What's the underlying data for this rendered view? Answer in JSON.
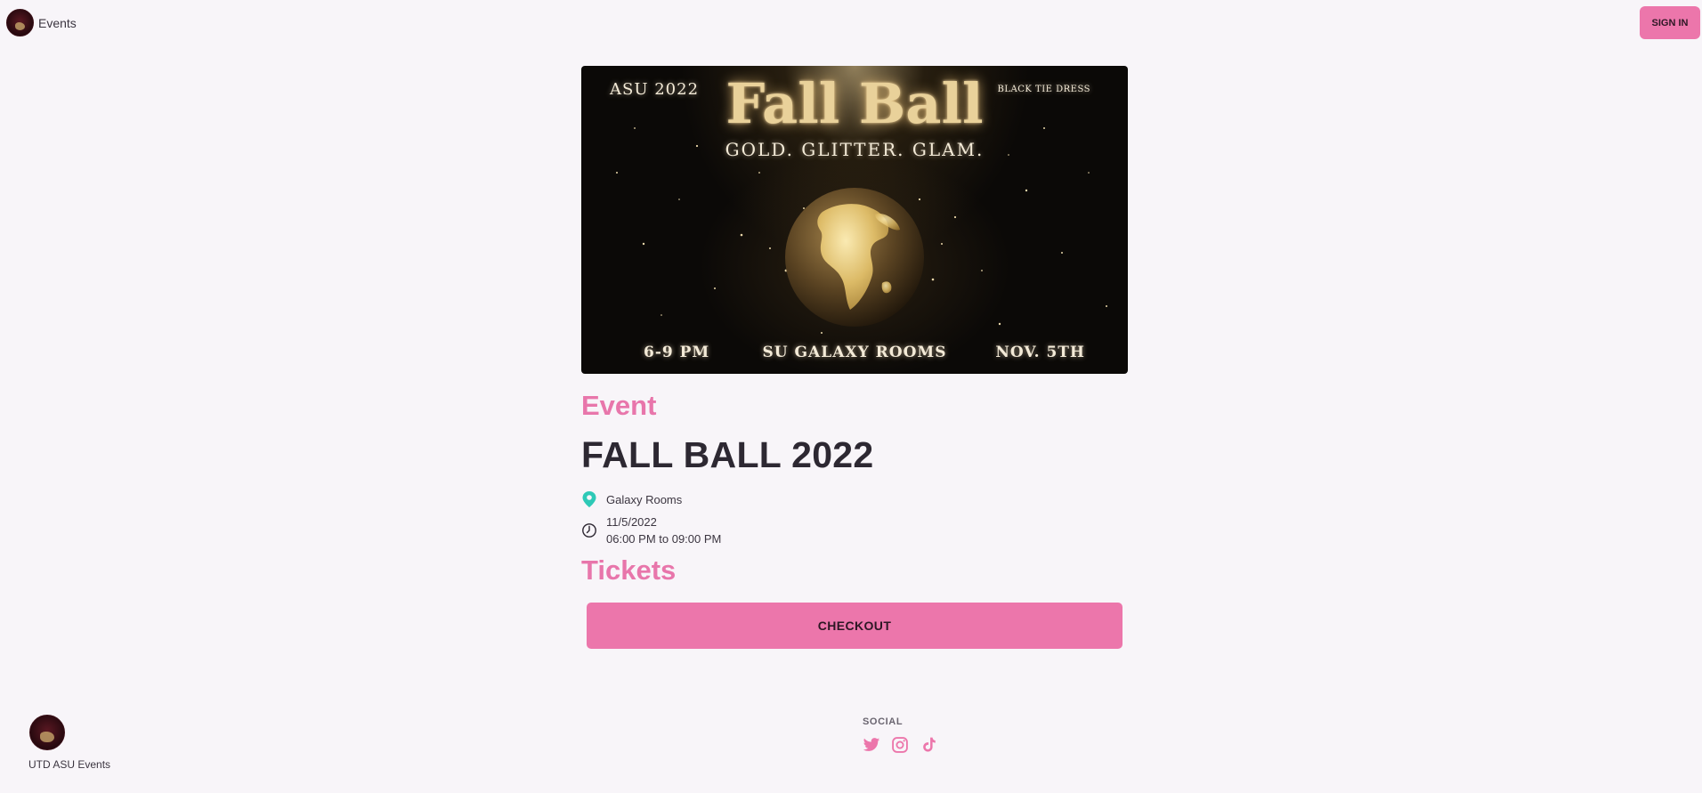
{
  "header": {
    "brand_label": "Events",
    "signin_label": "SIGN IN"
  },
  "poster": {
    "top_left": "ASU 2022",
    "title": "Fall Ball",
    "top_right": "BLACK TIE DRESS",
    "subtitle": "GOLD. GLITTER. GLAM.",
    "bottom_left": "6-9 PM",
    "bottom_center": "SU GALAXY ROOMS",
    "bottom_right": "NOV. 5TH"
  },
  "event": {
    "section_label": "Event",
    "title": "FALL BALL 2022",
    "location": "Galaxy Rooms",
    "date": "11/5/2022",
    "time_range": "06:00 PM to 09:00 PM"
  },
  "tickets": {
    "section_label": "Tickets",
    "checkout_label": "CHECKOUT"
  },
  "footer": {
    "brand_name": "UTD ASU Events",
    "social_label": "SOCIAL",
    "icons": [
      "twitter-icon",
      "instagram-icon",
      "tiktok-icon"
    ]
  },
  "colors": {
    "accent": "#ec76ab",
    "accent_text": "#e876ab",
    "background": "#f8f5f9",
    "location_pin": "#2ec9b7"
  }
}
